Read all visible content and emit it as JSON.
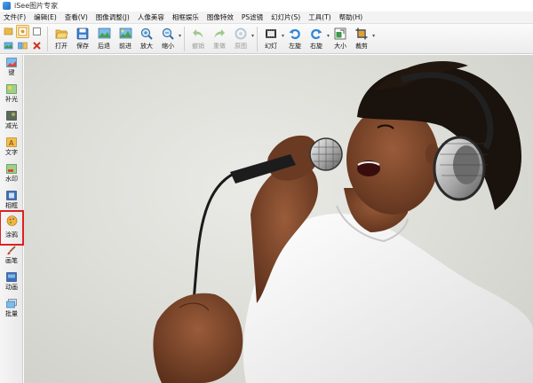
{
  "window": {
    "title": "iSee图片专家"
  },
  "menu": [
    {
      "label": "文件(F)"
    },
    {
      "label": "编辑(E)"
    },
    {
      "label": "查看(V)"
    },
    {
      "label": "图像调整(J)"
    },
    {
      "label": "人像美容"
    },
    {
      "label": "相框娱乐"
    },
    {
      "label": "图像特效"
    },
    {
      "label": "PS滤镜"
    },
    {
      "label": "幻灯片(S)"
    },
    {
      "label": "工具(T)"
    },
    {
      "label": "帮助(H)"
    }
  ],
  "toolbar": {
    "buttons": [
      {
        "label": "打开",
        "icon": "open-folder-icon",
        "enabled": true
      },
      {
        "label": "保存",
        "icon": "save-disk-icon",
        "enabled": true
      },
      {
        "label": "后退",
        "icon": "back-photo-icon",
        "enabled": true
      },
      {
        "label": "前进",
        "icon": "forward-photo-icon",
        "enabled": true
      },
      {
        "label": "放大",
        "icon": "zoom-in-icon",
        "enabled": true
      },
      {
        "label": "缩小",
        "icon": "zoom-out-icon",
        "enabled": true
      },
      {
        "label": "撤销",
        "icon": "undo-icon",
        "enabled": false
      },
      {
        "label": "重做",
        "icon": "redo-icon",
        "enabled": false
      },
      {
        "label": "原图",
        "icon": "original-icon",
        "enabled": false
      },
      {
        "label": "幻灯",
        "icon": "slideshow-icon",
        "enabled": true
      },
      {
        "label": "左旋",
        "icon": "rotate-left-icon",
        "enabled": true
      },
      {
        "label": "右旋",
        "icon": "rotate-right-icon",
        "enabled": true
      },
      {
        "label": "大小",
        "icon": "resize-icon",
        "enabled": true
      },
      {
        "label": "裁剪",
        "icon": "crop-icon",
        "enabled": true
      }
    ]
  },
  "sidebar": {
    "items": [
      {
        "label": "键",
        "icon": "one-key-icon"
      },
      {
        "label": "补光",
        "icon": "fill-light-icon"
      },
      {
        "label": "减光",
        "icon": "reduce-light-icon"
      },
      {
        "label": "文字",
        "icon": "text-icon"
      },
      {
        "label": "水印",
        "icon": "watermark-icon"
      },
      {
        "label": "相框",
        "icon": "photo-frame-icon"
      },
      {
        "label": "涂鸦",
        "icon": "doodle-icon",
        "highlighted": true
      },
      {
        "label": "画笔",
        "icon": "brush-icon"
      },
      {
        "label": "动画",
        "icon": "animation-icon"
      },
      {
        "label": "批量",
        "icon": "batch-icon"
      }
    ]
  },
  "colors": {
    "highlight": "#e02020",
    "accent": "#2f86d6"
  }
}
